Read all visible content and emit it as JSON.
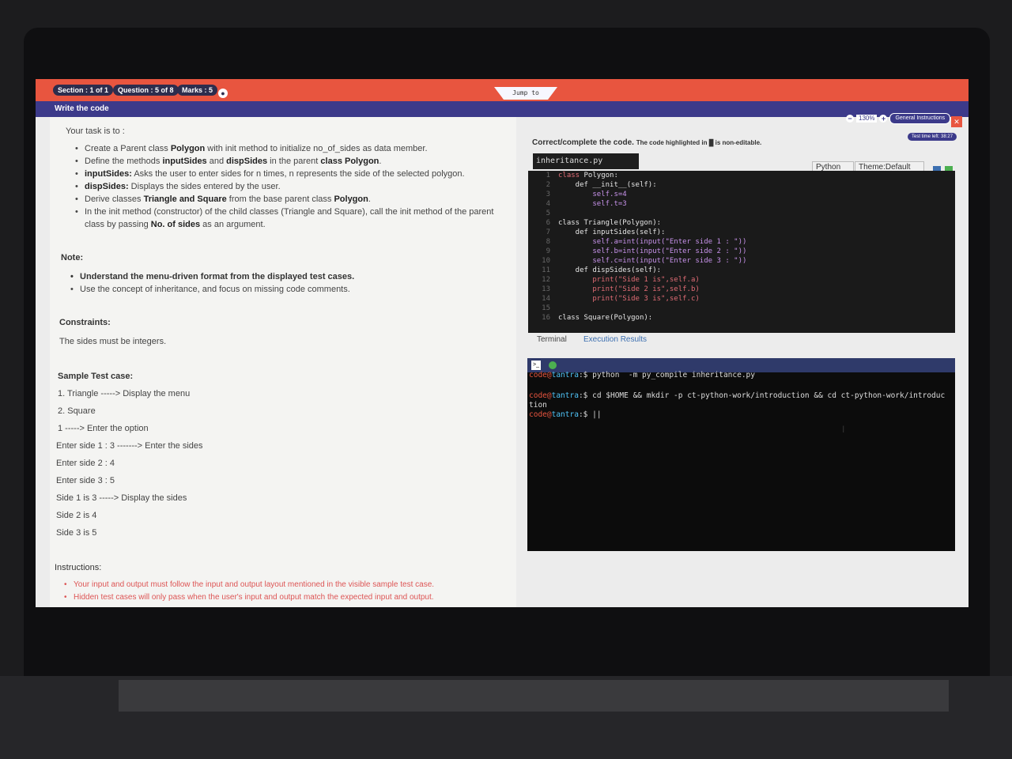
{
  "header": {
    "section": "Section : 1 of 1",
    "question": "Question : 5 of 8",
    "marks": "Marks : 5",
    "jump": "Jump to",
    "title": "Write the code",
    "zoom": "130%",
    "general_instructions": "General Instructions",
    "time_left": "Test time left: 38:27"
  },
  "task": {
    "intro": "Your task is to :",
    "bullets": [
      [
        "Create a Parent class ",
        "Polygon",
        " with init method to initialize no_of_sides as data member."
      ],
      [
        "Define the methods ",
        "inputSides",
        " and ",
        "dispSides",
        " in the parent ",
        "class Polygon",
        "."
      ],
      [
        "",
        "inputSides:",
        " Asks the user to enter sides for n times, n represents the side of the selected polygon."
      ],
      [
        "",
        "dispSides:",
        " Displays the sides entered by the user."
      ],
      [
        "Derive classes ",
        "Triangle and Square",
        " from the base parent class ",
        "Polygon",
        "."
      ],
      [
        "In the init method (constructor) of the child classes (Triangle and Square), call the init method of the parent"
      ]
    ],
    "bullet6_line2_a": "class by passing ",
    "bullet6_line2_b": "No. of sides",
    "bullet6_line2_c": " as an argument."
  },
  "note": {
    "label": "Note:",
    "items": [
      "Understand the menu-driven format from the displayed test cases.",
      "Use the concept of inheritance, and focus on missing code comments."
    ]
  },
  "constraints": {
    "label": "Constraints:",
    "text": "The sides must be integers."
  },
  "sample": {
    "label": "Sample Test case:",
    "lines": [
      "1. Triangle -----> Display the menu",
      "2. Square",
      "1 -----> Enter the option",
      "Enter side 1 : 3 -------> Enter the sides",
      "Enter side 2 : 4",
      "Enter side 3 : 5",
      "Side 1 is 3 -----> Display the sides",
      "Side 2 is 4",
      "Side 3 is 5"
    ]
  },
  "instructions": {
    "label": "Instructions:",
    "items": [
      "Your input and output must follow the input and output layout mentioned in the visible sample test case.",
      "Hidden test cases will only pass when the user's input and output match the expected input and output."
    ]
  },
  "editor": {
    "heading": "Correct/complete the code.",
    "heading_note": "The code highlighted in █ is non-editable.",
    "filename": "inheritance.py",
    "language": "Python",
    "theme": "Theme:Default",
    "lines": [
      "class Polygon:",
      "    def __init__(self):",
      "        self.s=4",
      "        self.t=3",
      "",
      "class Triangle(Polygon):",
      "    def inputSides(self):",
      "        self.a=int(input(\"Enter side 1 : \"))",
      "        self.b=int(input(\"Enter side 2 : \"))",
      "        self.c=int(input(\"Enter side 3 : \"))",
      "    def dispSides(self):",
      "        print(\"Side 1 is\",self.a)",
      "        print(\"Side 2 is\",self.b)",
      "        print(\"Side 3 is\",self.c)",
      "",
      "class Square(Polygon):"
    ]
  },
  "tabs": {
    "terminal": "Terminal",
    "results": "Execution Results"
  },
  "terminal": {
    "user": "code@",
    "host": "tantra",
    "cmd1": ":$ python  -m py_compile inheritance.py",
    "cmd2": ":$ cd $HOME && mkdir -p ct-python-work/introduction && cd ct-python-work/introduc",
    "cmd2_wrap": "tion",
    "cmd3": ":$ ||"
  },
  "colors": {
    "topbar": "#e8553f",
    "subbar": "#3c3a8a",
    "editor_bg": "#1a1a1a"
  }
}
